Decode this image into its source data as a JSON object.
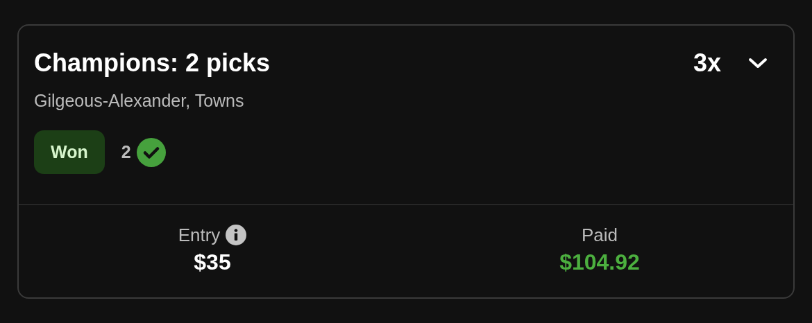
{
  "card": {
    "title": "Champions: 2 picks",
    "multiplier": "3x",
    "expanded": false,
    "players": "Gilgeous-Alexander, Towns",
    "status": {
      "label": "Won",
      "kind": "won"
    },
    "correct_count": "2",
    "stats": [
      {
        "label": "Entry",
        "value": "$35",
        "kind": "entry"
      },
      {
        "label": "Paid",
        "value": "$104.92",
        "kind": "payout"
      }
    ]
  }
}
